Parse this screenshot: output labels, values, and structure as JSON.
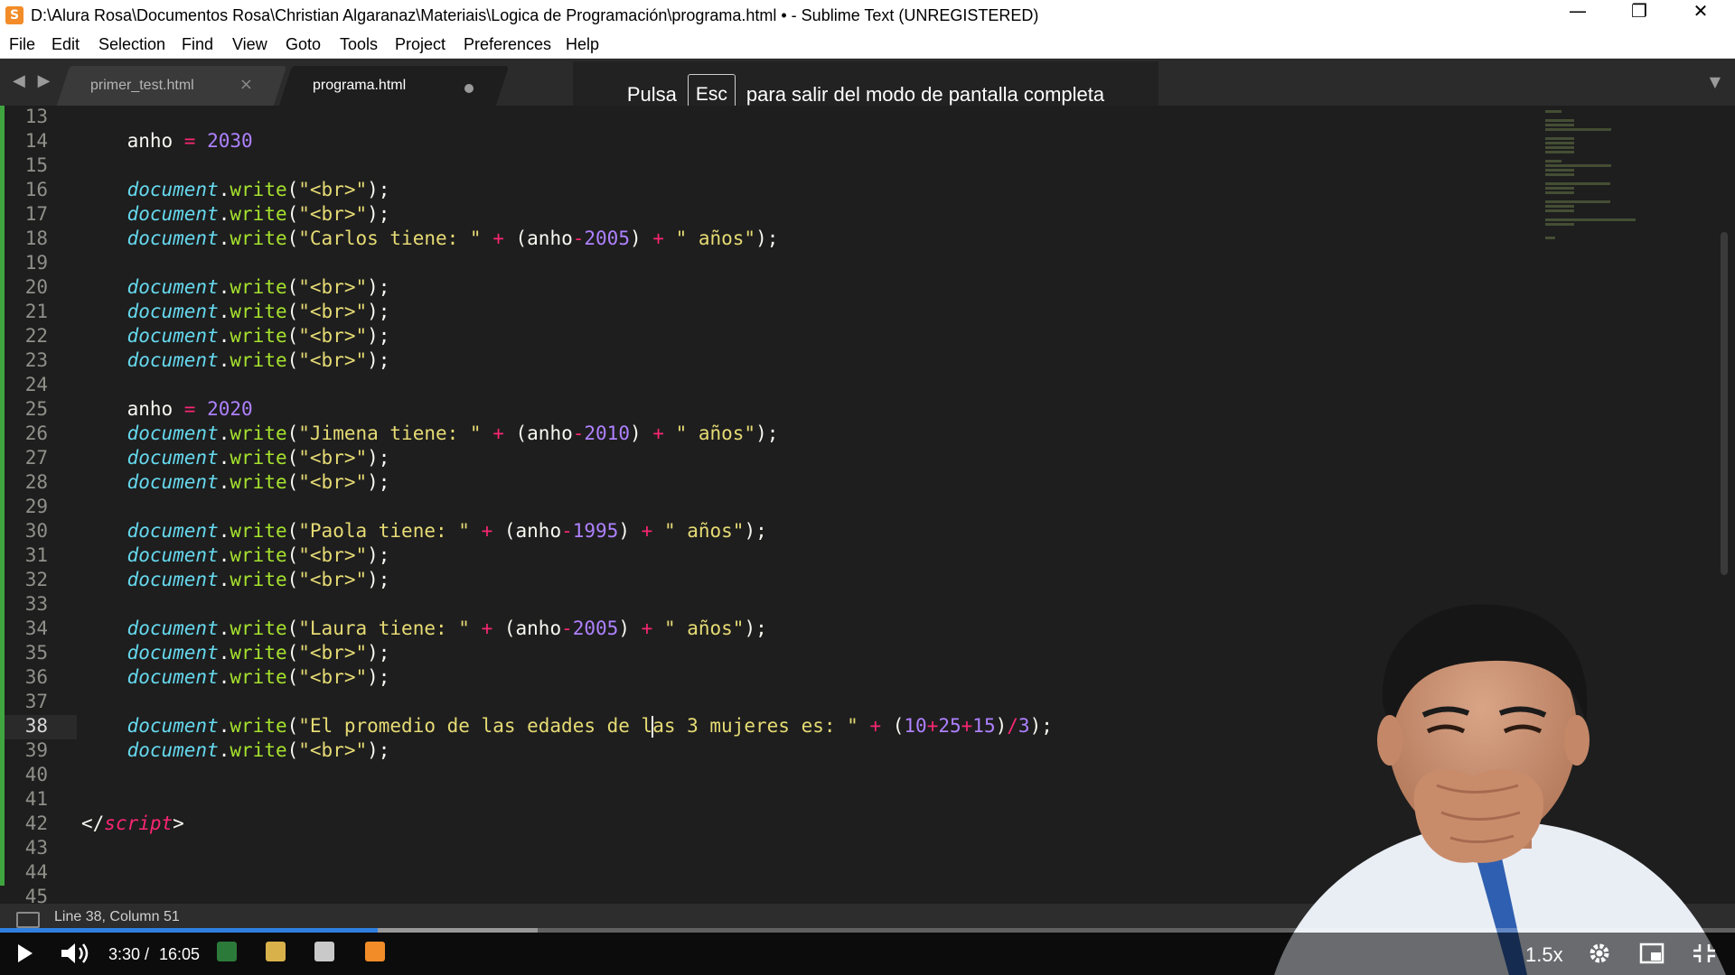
{
  "window": {
    "title": "D:\\Alura Rosa\\Documentos Rosa\\Christian Algaranaz\\Materiais\\Logica de Programación\\programa.html • - Sublime Text (UNREGISTERED)",
    "app_icon_glyph": "S",
    "minimize": "—",
    "restore": "❐",
    "close": "✕"
  },
  "menu": [
    "File",
    "Edit",
    "Selection",
    "Find",
    "View",
    "Goto",
    "Tools",
    "Project",
    "Preferences",
    "Help"
  ],
  "tabs": [
    {
      "label": "primer_test.html",
      "active": false,
      "close": "×"
    },
    {
      "label": "programa.html",
      "active": true,
      "dirty": true
    }
  ],
  "tab_nav": "◀ ▶",
  "tab_dropdown": "▼",
  "fullscreen_notice": {
    "before": "Pulsa",
    "key": "Esc",
    "after": "para salir del modo de pantalla completa"
  },
  "editor": {
    "current_line": 38,
    "line_numbers": [
      13,
      14,
      15,
      16,
      17,
      18,
      19,
      20,
      21,
      22,
      23,
      24,
      25,
      26,
      27,
      28,
      29,
      30,
      31,
      32,
      33,
      34,
      35,
      36,
      37,
      38,
      39,
      40,
      41,
      42,
      43,
      44,
      45
    ],
    "lines": [
      [],
      [
        [
          "    anho ",
          "p"
        ],
        [
          "=",
          "op"
        ],
        [
          " ",
          "p"
        ],
        [
          "2030",
          "num"
        ]
      ],
      [],
      [
        [
          "    ",
          "p"
        ],
        [
          "document",
          "obj"
        ],
        [
          ".",
          "p"
        ],
        [
          "write",
          "fn"
        ],
        [
          "(",
          "p"
        ],
        [
          "\"<br>\"",
          "str"
        ],
        [
          ");",
          "p"
        ]
      ],
      [
        [
          "    ",
          "p"
        ],
        [
          "document",
          "obj"
        ],
        [
          ".",
          "p"
        ],
        [
          "write",
          "fn"
        ],
        [
          "(",
          "p"
        ],
        [
          "\"<br>\"",
          "str"
        ],
        [
          ");",
          "p"
        ]
      ],
      [
        [
          "    ",
          "p"
        ],
        [
          "document",
          "obj"
        ],
        [
          ".",
          "p"
        ],
        [
          "write",
          "fn"
        ],
        [
          "(",
          "p"
        ],
        [
          "\"Carlos tiene: \"",
          "str"
        ],
        [
          " ",
          "p"
        ],
        [
          "+",
          "op"
        ],
        [
          " (anho",
          "p"
        ],
        [
          "-",
          "op"
        ],
        [
          "2005",
          "num"
        ],
        [
          ") ",
          "p"
        ],
        [
          "+",
          "op"
        ],
        [
          " ",
          "p"
        ],
        [
          "\" años\"",
          "str"
        ],
        [
          ");",
          "p"
        ]
      ],
      [],
      [
        [
          "    ",
          "p"
        ],
        [
          "document",
          "obj"
        ],
        [
          ".",
          "p"
        ],
        [
          "write",
          "fn"
        ],
        [
          "(",
          "p"
        ],
        [
          "\"<br>\"",
          "str"
        ],
        [
          ");",
          "p"
        ]
      ],
      [
        [
          "    ",
          "p"
        ],
        [
          "document",
          "obj"
        ],
        [
          ".",
          "p"
        ],
        [
          "write",
          "fn"
        ],
        [
          "(",
          "p"
        ],
        [
          "\"<br>\"",
          "str"
        ],
        [
          ");",
          "p"
        ]
      ],
      [
        [
          "    ",
          "p"
        ],
        [
          "document",
          "obj"
        ],
        [
          ".",
          "p"
        ],
        [
          "write",
          "fn"
        ],
        [
          "(",
          "p"
        ],
        [
          "\"<br>\"",
          "str"
        ],
        [
          ");",
          "p"
        ]
      ],
      [
        [
          "    ",
          "p"
        ],
        [
          "document",
          "obj"
        ],
        [
          ".",
          "p"
        ],
        [
          "write",
          "fn"
        ],
        [
          "(",
          "p"
        ],
        [
          "\"<br>\"",
          "str"
        ],
        [
          ");",
          "p"
        ]
      ],
      [],
      [
        [
          "    anho ",
          "p"
        ],
        [
          "=",
          "op"
        ],
        [
          " ",
          "p"
        ],
        [
          "2020",
          "num"
        ]
      ],
      [
        [
          "    ",
          "p"
        ],
        [
          "document",
          "obj"
        ],
        [
          ".",
          "p"
        ],
        [
          "write",
          "fn"
        ],
        [
          "(",
          "p"
        ],
        [
          "\"Jimena tiene: \"",
          "str"
        ],
        [
          " ",
          "p"
        ],
        [
          "+",
          "op"
        ],
        [
          " (anho",
          "p"
        ],
        [
          "-",
          "op"
        ],
        [
          "2010",
          "num"
        ],
        [
          ") ",
          "p"
        ],
        [
          "+",
          "op"
        ],
        [
          " ",
          "p"
        ],
        [
          "\" años\"",
          "str"
        ],
        [
          ");",
          "p"
        ]
      ],
      [
        [
          "    ",
          "p"
        ],
        [
          "document",
          "obj"
        ],
        [
          ".",
          "p"
        ],
        [
          "write",
          "fn"
        ],
        [
          "(",
          "p"
        ],
        [
          "\"<br>\"",
          "str"
        ],
        [
          ");",
          "p"
        ]
      ],
      [
        [
          "    ",
          "p"
        ],
        [
          "document",
          "obj"
        ],
        [
          ".",
          "p"
        ],
        [
          "write",
          "fn"
        ],
        [
          "(",
          "p"
        ],
        [
          "\"<br>\"",
          "str"
        ],
        [
          ");",
          "p"
        ]
      ],
      [],
      [
        [
          "    ",
          "p"
        ],
        [
          "document",
          "obj"
        ],
        [
          ".",
          "p"
        ],
        [
          "write",
          "fn"
        ],
        [
          "(",
          "p"
        ],
        [
          "\"Paola tiene: \"",
          "str"
        ],
        [
          " ",
          "p"
        ],
        [
          "+",
          "op"
        ],
        [
          " (anho",
          "p"
        ],
        [
          "-",
          "op"
        ],
        [
          "1995",
          "num"
        ],
        [
          ") ",
          "p"
        ],
        [
          "+",
          "op"
        ],
        [
          " ",
          "p"
        ],
        [
          "\" años\"",
          "str"
        ],
        [
          ");",
          "p"
        ]
      ],
      [
        [
          "    ",
          "p"
        ],
        [
          "document",
          "obj"
        ],
        [
          ".",
          "p"
        ],
        [
          "write",
          "fn"
        ],
        [
          "(",
          "p"
        ],
        [
          "\"<br>\"",
          "str"
        ],
        [
          ");",
          "p"
        ]
      ],
      [
        [
          "    ",
          "p"
        ],
        [
          "document",
          "obj"
        ],
        [
          ".",
          "p"
        ],
        [
          "write",
          "fn"
        ],
        [
          "(",
          "p"
        ],
        [
          "\"<br>\"",
          "str"
        ],
        [
          ");",
          "p"
        ]
      ],
      [],
      [
        [
          "    ",
          "p"
        ],
        [
          "document",
          "obj"
        ],
        [
          ".",
          "p"
        ],
        [
          "write",
          "fn"
        ],
        [
          "(",
          "p"
        ],
        [
          "\"Laura tiene: \"",
          "str"
        ],
        [
          " ",
          "p"
        ],
        [
          "+",
          "op"
        ],
        [
          " (anho",
          "p"
        ],
        [
          "-",
          "op"
        ],
        [
          "2005",
          "num"
        ],
        [
          ") ",
          "p"
        ],
        [
          "+",
          "op"
        ],
        [
          " ",
          "p"
        ],
        [
          "\" años\"",
          "str"
        ],
        [
          ");",
          "p"
        ]
      ],
      [
        [
          "    ",
          "p"
        ],
        [
          "document",
          "obj"
        ],
        [
          ".",
          "p"
        ],
        [
          "write",
          "fn"
        ],
        [
          "(",
          "p"
        ],
        [
          "\"<br>\"",
          "str"
        ],
        [
          ");",
          "p"
        ]
      ],
      [
        [
          "    ",
          "p"
        ],
        [
          "document",
          "obj"
        ],
        [
          ".",
          "p"
        ],
        [
          "write",
          "fn"
        ],
        [
          "(",
          "p"
        ],
        [
          "\"<br>\"",
          "str"
        ],
        [
          ");",
          "p"
        ]
      ],
      [],
      [
        [
          "    ",
          "p"
        ],
        [
          "document",
          "obj"
        ],
        [
          ".",
          "p"
        ],
        [
          "write",
          "fn"
        ],
        [
          "(",
          "p"
        ],
        [
          "\"El promedio de las edades de l",
          "str"
        ],
        [
          "",
          "caret"
        ],
        [
          "as 3 mujeres es: \"",
          "str"
        ],
        [
          " ",
          "p"
        ],
        [
          "+",
          "op"
        ],
        [
          " (",
          "p"
        ],
        [
          "10",
          "num"
        ],
        [
          "+",
          "op"
        ],
        [
          "25",
          "num"
        ],
        [
          "+",
          "op"
        ],
        [
          "15",
          "num"
        ],
        [
          ")",
          "p"
        ],
        [
          "/",
          "op"
        ],
        [
          "3",
          "num"
        ],
        [
          ");",
          "p"
        ]
      ],
      [
        [
          "    ",
          "p"
        ],
        [
          "document",
          "obj"
        ],
        [
          ".",
          "p"
        ],
        [
          "write",
          "fn"
        ],
        [
          "(",
          "p"
        ],
        [
          "\"<br>\"",
          "str"
        ],
        [
          ");",
          "p"
        ]
      ],
      [],
      [],
      [
        [
          "</",
          "p"
        ],
        [
          "script",
          "tag"
        ],
        [
          ">",
          "p"
        ]
      ],
      [],
      [],
      []
    ]
  },
  "status": {
    "text": "Line 38, Column 51"
  },
  "player": {
    "current_time": "3:30",
    "separator": "/",
    "duration": "16:05",
    "played_fraction": 0.2176,
    "buffered_fraction": 0.31,
    "speed": "1.5x",
    "play_icon": "play-icon",
    "volume_icon": "volume-icon",
    "settings_icon": "gear-icon",
    "pip_icon": "picture-in-picture-icon",
    "fullscreen_icon": "fullscreen-exit-icon"
  },
  "colors": {
    "accent_progress": "#2f7fe0",
    "editor_bg": "#1e1e1e",
    "keyword_pink": "#f92672",
    "number_purple": "#ae81ff",
    "string_yellow": "#e6db74",
    "object_cyan": "#66d9ef",
    "function_green": "#a6e22e"
  }
}
